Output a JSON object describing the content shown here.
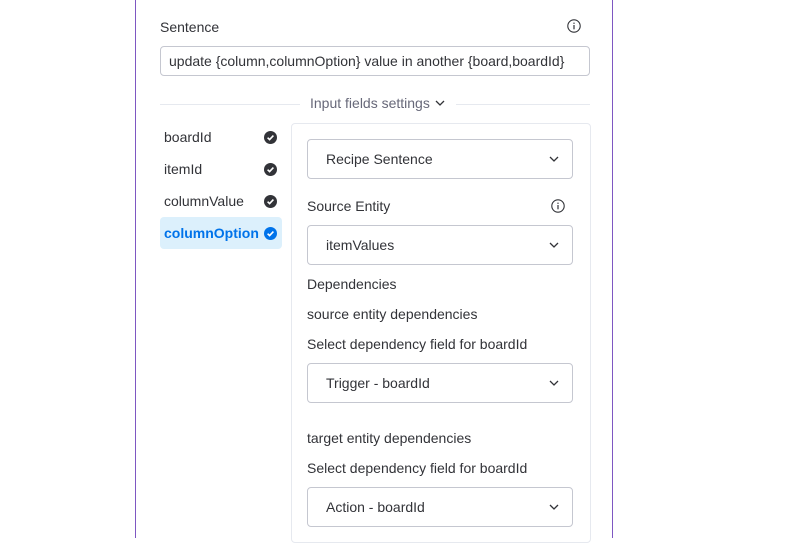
{
  "sentence": {
    "label": "Sentence",
    "value": "update {column,columnOption} value in another {board,boardId}"
  },
  "input_fields_settings": {
    "label": "Input fields settings"
  },
  "fields": [
    {
      "label": "boardId",
      "status": "complete"
    },
    {
      "label": "itemId",
      "status": "complete"
    },
    {
      "label": "columnValue",
      "status": "complete"
    },
    {
      "label": "columnOption",
      "status": "selected"
    }
  ],
  "settings": {
    "type_dropdown": "Recipe Sentence",
    "source_entity_label": "Source Entity",
    "source_entity_value": "itemValues",
    "dependencies_label": "Dependencies",
    "source_deps_label": "source entity dependencies",
    "source_select_label": "Select dependency field for boardId",
    "source_select_value": "Trigger - boardId",
    "target_deps_label": "target entity dependencies",
    "target_select_label": "Select dependency field for boardId",
    "target_select_value": "Action - boardId"
  },
  "colors": {
    "panel_border": "#7e57c2",
    "accent": "#0073ea",
    "selected_bg": "#dcf0fc",
    "text": "#323338"
  }
}
